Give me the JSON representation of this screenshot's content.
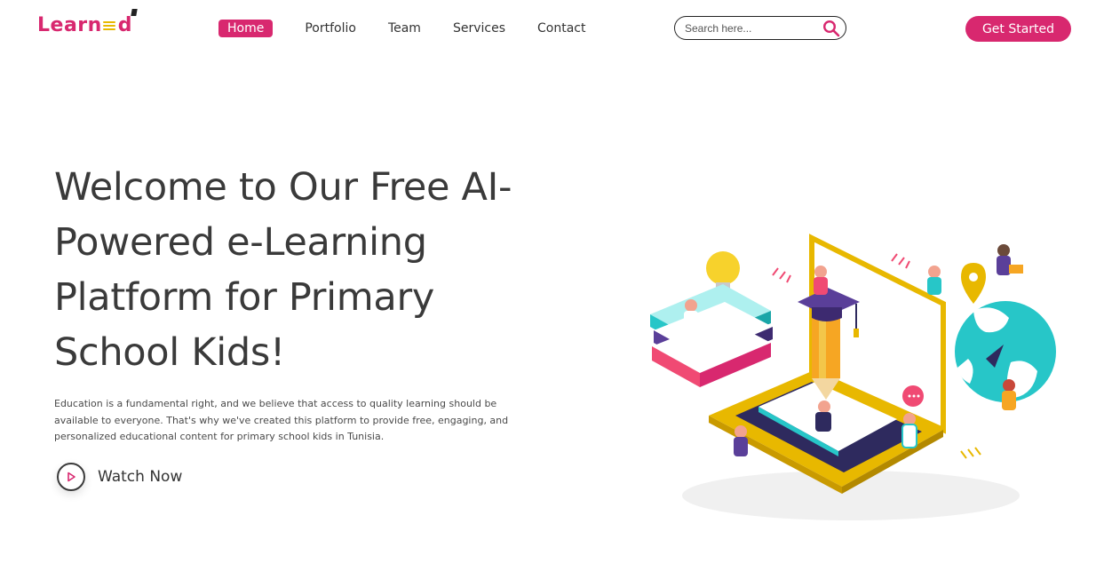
{
  "header": {
    "logo_text_start": "Learn",
    "logo_text_end": "d",
    "nav": [
      {
        "label": "Home",
        "active": true
      },
      {
        "label": "Portfolio",
        "active": false
      },
      {
        "label": "Team",
        "active": false
      },
      {
        "label": "Services",
        "active": false
      },
      {
        "label": "Contact",
        "active": false
      }
    ],
    "search": {
      "placeholder": "Search here..."
    },
    "cta_label": "Get Started"
  },
  "hero": {
    "title": "Welcome to Our Free AI-Powered e-Learning Platform for Primary School Kids!",
    "description": "Education is a fundamental right, and we believe that access to quality learning should be available to everyone. That's why we've created this platform to provide free, engaging, and personalized educational content for primary school kids in Tunisia.",
    "watch_label": "Watch Now"
  },
  "colors": {
    "accent": "#d8286f",
    "gold": "#e8b800",
    "teal": "#27c6c8",
    "navy": "#2e2a5e"
  },
  "icons": {
    "search": "search-icon",
    "play": "play-icon"
  }
}
